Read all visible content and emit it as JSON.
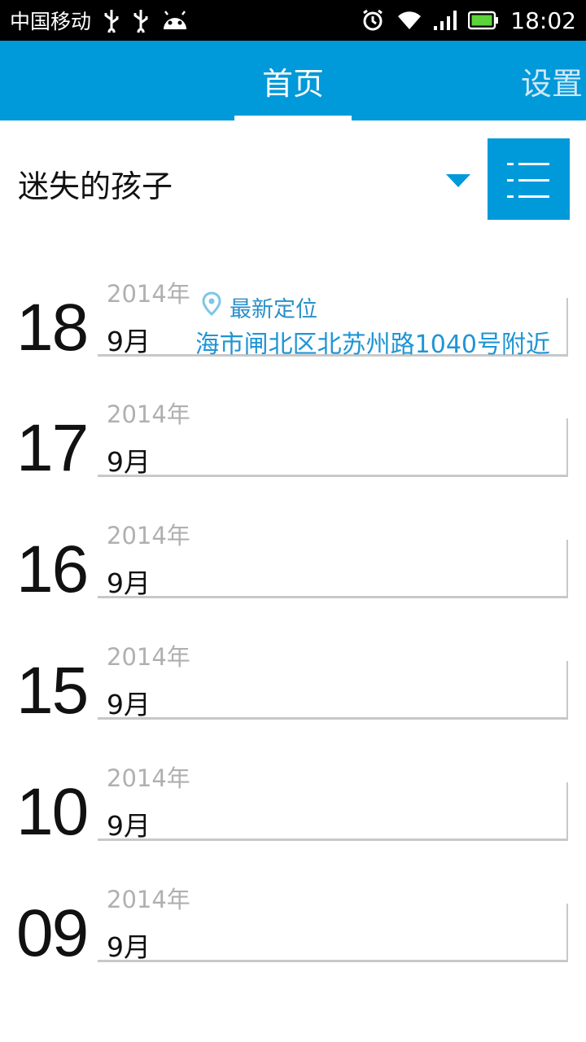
{
  "status_bar": {
    "carrier": "中国移动",
    "time": "18:02"
  },
  "nav": {
    "tabs": [
      {
        "label": "首页",
        "active": true
      },
      {
        "label": "设置",
        "active": false
      }
    ],
    "accent": "#0099d9"
  },
  "selector": {
    "title": "迷失的孩子"
  },
  "location": {
    "label": "最新定位",
    "address": "海市闸北区北苏州路1040号附近"
  },
  "entries": [
    {
      "day": "18",
      "year": "2014年",
      "month": "9月"
    },
    {
      "day": "17",
      "year": "2014年",
      "month": "9月"
    },
    {
      "day": "16",
      "year": "2014年",
      "month": "9月"
    },
    {
      "day": "15",
      "year": "2014年",
      "month": "9月"
    },
    {
      "day": "10",
      "year": "2014年",
      "month": "9月"
    },
    {
      "day": "09",
      "year": "2014年",
      "month": "9月"
    }
  ]
}
